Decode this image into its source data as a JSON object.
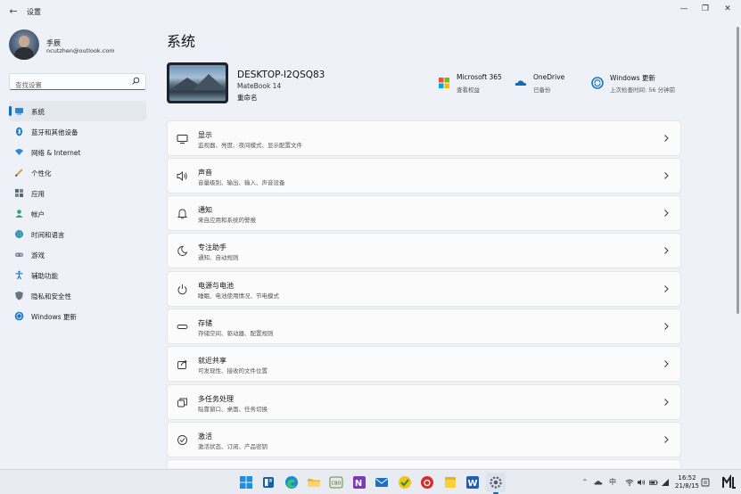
{
  "window": {
    "title": "设置"
  },
  "profile": {
    "name": "手辰",
    "email": "ncutzhen@outlook.com"
  },
  "search": {
    "placeholder": "查找设置"
  },
  "sidebar": {
    "items": [
      {
        "label": "系统",
        "icon": "system-icon",
        "active": true
      },
      {
        "label": "蓝牙和其他设备",
        "icon": "bluetooth-icon"
      },
      {
        "label": "网络 & Internet",
        "icon": "network-icon"
      },
      {
        "label": "个性化",
        "icon": "personalization-icon"
      },
      {
        "label": "应用",
        "icon": "apps-icon"
      },
      {
        "label": "帐户",
        "icon": "account-icon"
      },
      {
        "label": "时间和语言",
        "icon": "time-language-icon"
      },
      {
        "label": "游戏",
        "icon": "gaming-icon"
      },
      {
        "label": "辅助功能",
        "icon": "accessibility-icon"
      },
      {
        "label": "隐私和安全性",
        "icon": "privacy-icon"
      },
      {
        "label": "Windows 更新",
        "icon": "windows-update-icon"
      }
    ]
  },
  "main": {
    "title": "系统",
    "device": {
      "name": "DESKTOP-I2QSQ83",
      "model": "MateBook 14",
      "rename_label": "重命名"
    },
    "services": [
      {
        "title": "Microsoft 365",
        "subtitle": "查看权益",
        "icon": "microsoft365-icon"
      },
      {
        "title": "OneDrive",
        "subtitle": "已备份",
        "icon": "onedrive-icon"
      },
      {
        "title": "Windows 更新",
        "subtitle": "上次检查时间: 56 分钟前",
        "icon": "windows-update-icon"
      }
    ],
    "cards": [
      {
        "title": "显示",
        "subtitle": "监视器、亮度、夜间模式、显示配置文件",
        "icon": "display-icon"
      },
      {
        "title": "声音",
        "subtitle": "音量级别、输出、输入、声音设备",
        "icon": "sound-icon"
      },
      {
        "title": "通知",
        "subtitle": "来自应用和系统的警报",
        "icon": "notifications-icon"
      },
      {
        "title": "专注助手",
        "subtitle": "通知、自动规则",
        "icon": "focus-assist-icon"
      },
      {
        "title": "电源与电池",
        "subtitle": "睡眠、电池使用情况、节电模式",
        "icon": "power-icon"
      },
      {
        "title": "存储",
        "subtitle": "存储空间、驱动器、配置规则",
        "icon": "storage-icon"
      },
      {
        "title": "就近共享",
        "subtitle": "可发现性、接收的文件位置",
        "icon": "nearby-sharing-icon"
      },
      {
        "title": "多任务处理",
        "subtitle": "贴靠窗口、桌面、任务切换",
        "icon": "multitasking-icon"
      },
      {
        "title": "激活",
        "subtitle": "激活状态、订阅、产品密钥",
        "icon": "activation-icon"
      }
    ]
  },
  "taskbar": {
    "apps": [
      "start-icon",
      "widgets-icon",
      "edge-icon",
      "file-explorer-icon",
      "app-icon",
      "onenote-icon",
      "mail-icon",
      "app-icon",
      "netease-music-icon",
      "sticky-notes-icon",
      "word-icon",
      "settings-icon"
    ],
    "ime": "中",
    "time": "16:52",
    "date": "21/8/15"
  },
  "colors": {
    "accent": "#0f6cbd",
    "background": "#eef2f8",
    "card": "#fbfbfc"
  }
}
